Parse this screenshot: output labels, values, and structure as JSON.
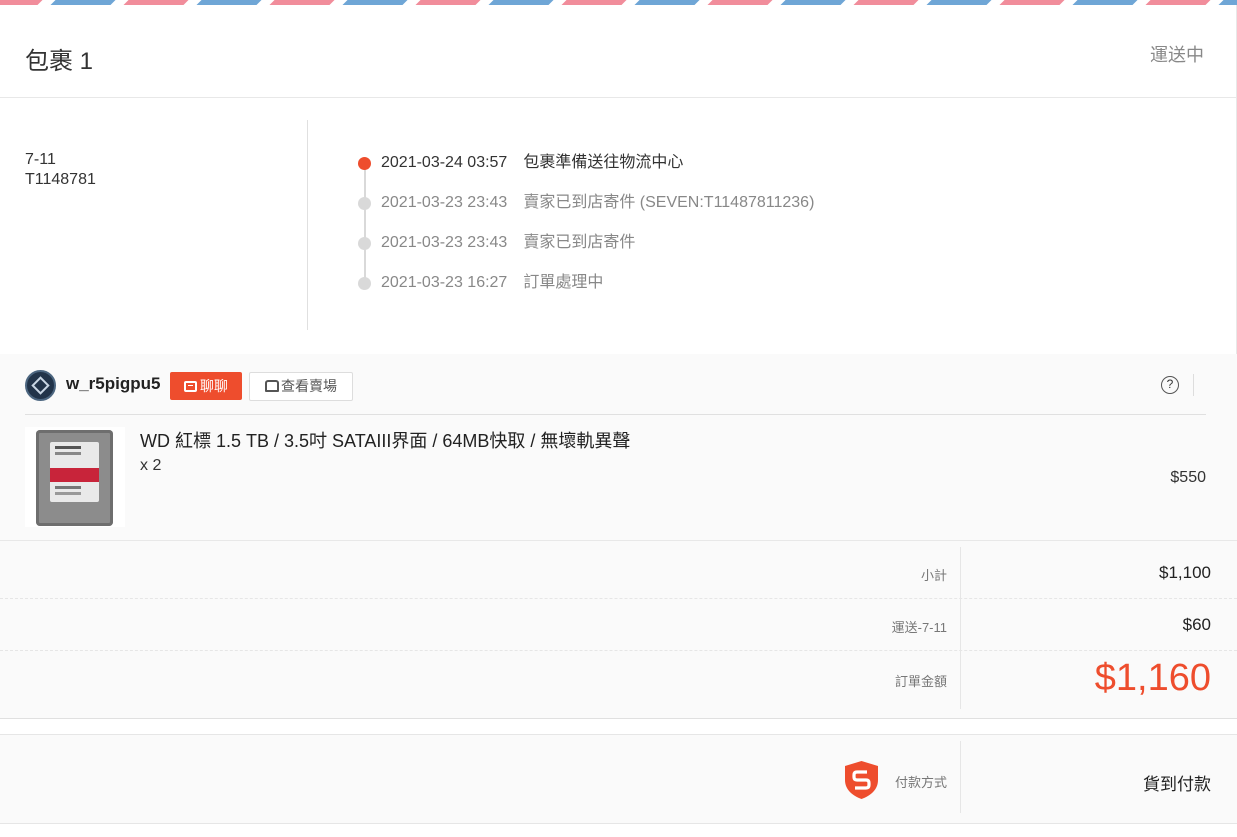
{
  "package": {
    "title": "包裹 1",
    "status": "運送中"
  },
  "carrier": {
    "name": "7-11",
    "tracking_no": "T1148781"
  },
  "timeline": [
    {
      "time": "2021-03-24 03:57",
      "desc": "包裹準備送往物流中心",
      "active": true
    },
    {
      "time": "2021-03-23 23:43",
      "desc": "賣家已到店寄件 (SEVEN:T11487811236)",
      "active": false
    },
    {
      "time": "2021-03-23 23:43",
      "desc": "賣家已到店寄件",
      "active": false
    },
    {
      "time": "2021-03-23 16:27",
      "desc": "訂單處理中",
      "active": false
    }
  ],
  "shop": {
    "name": "w_r5pigpu5",
    "chat_label": "聊聊",
    "view_shop_label": "查看賣場",
    "help_icon": "?"
  },
  "product": {
    "name": "WD 紅標 1.5 TB / 3.5吋 SATAIII界面 / 64MB快取 / 無壞軌異聲",
    "quantity": "x 2",
    "price": "$550"
  },
  "summary": {
    "subtotal_label": "小計",
    "subtotal_value": "$1,100",
    "shipping_label": "運送-7-11",
    "shipping_value": "$60",
    "total_label": "訂單金額",
    "total_value": "$1,160"
  },
  "payment": {
    "label": "付款方式",
    "value": "貨到付款"
  },
  "colors": {
    "accent": "#ee4d2d",
    "stripe_red": "#f18d9b",
    "stripe_blue": "#6fa6d6"
  }
}
